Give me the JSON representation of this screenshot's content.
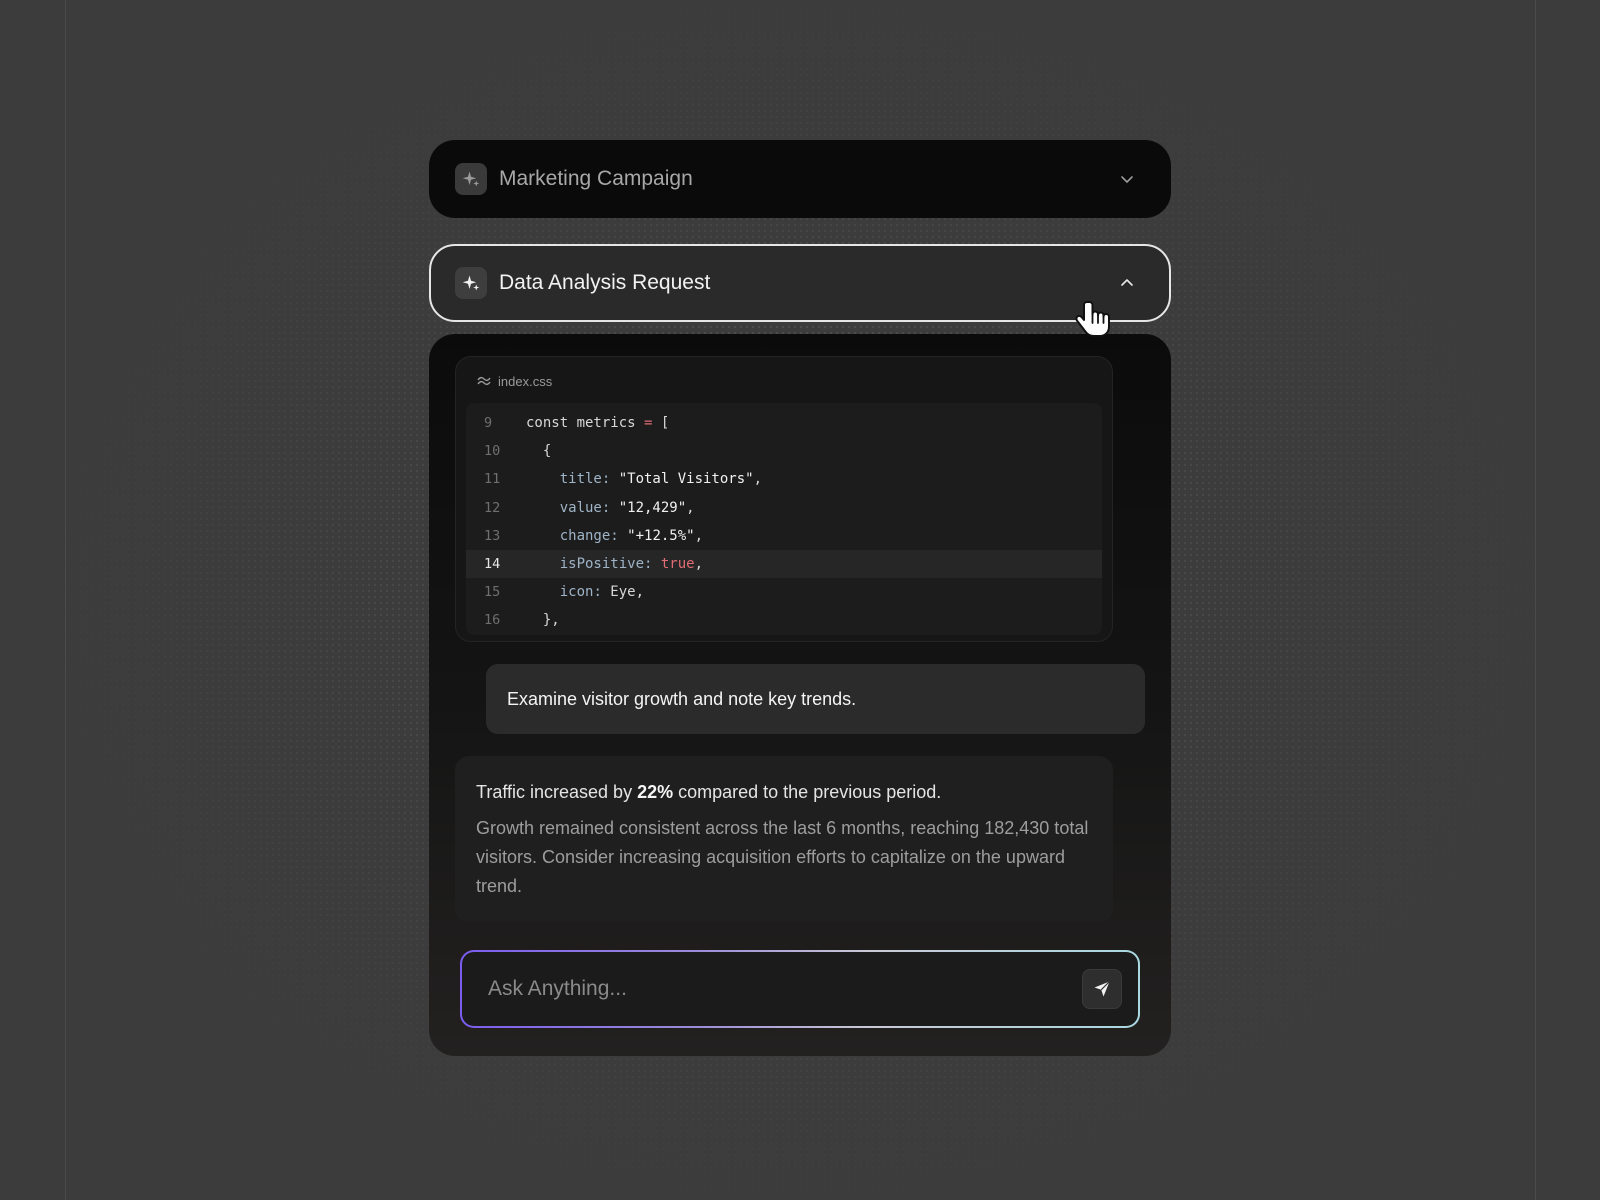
{
  "accordion": [
    {
      "title": "Marketing Campaign",
      "expanded": false,
      "icon": "sparkle-icon"
    },
    {
      "title": "Data Analysis Request",
      "expanded": true,
      "icon": "sparkle-icon"
    }
  ],
  "code": {
    "filename": "index.css",
    "highlighted_line": 14,
    "lines": [
      {
        "n": "9"
      },
      {
        "n": "10"
      },
      {
        "n": "11"
      },
      {
        "n": "12"
      },
      {
        "n": "13"
      },
      {
        "n": "14"
      },
      {
        "n": "15"
      },
      {
        "n": "16"
      }
    ],
    "tokens": {
      "l9_a": "const metrics ",
      "l9_b": "=",
      "l9_c": " [",
      "l10": "  {",
      "l11_k": "    title",
      "l11_c": ": ",
      "l11_v": "\"Total Visitors\"",
      "l11_e": ",",
      "l12_k": "    value",
      "l12_c": ": ",
      "l12_v": "\"12,429\"",
      "l12_e": ",",
      "l13_k": "    change",
      "l13_c": ": ",
      "l13_v": "\"+12.5%\"",
      "l13_e": ",",
      "l14_k": "    isPositive",
      "l14_c": ": ",
      "l14_v": "true",
      "l14_e": ",",
      "l15_k": "    icon",
      "l15_c": ": ",
      "l15_v": "Eye",
      "l15_e": ",",
      "l16": "  },"
    }
  },
  "user_message": "Examine visitor growth and note key trends.",
  "reply": {
    "lead_before": "Traffic increased by ",
    "lead_bold": "22%",
    "lead_after": " compared to the previous period.",
    "body": "Growth remained consistent across the last 6 months, reaching 182,430 total visitors. Consider increasing acquisition efforts to capitalize on the upward trend."
  },
  "input": {
    "placeholder": "Ask Anything...",
    "value": ""
  },
  "colors": {
    "accent_gradient_start": "#7a5cf0",
    "accent_gradient_end": "#a8d8e0",
    "keyword_red": "#e06c75"
  }
}
